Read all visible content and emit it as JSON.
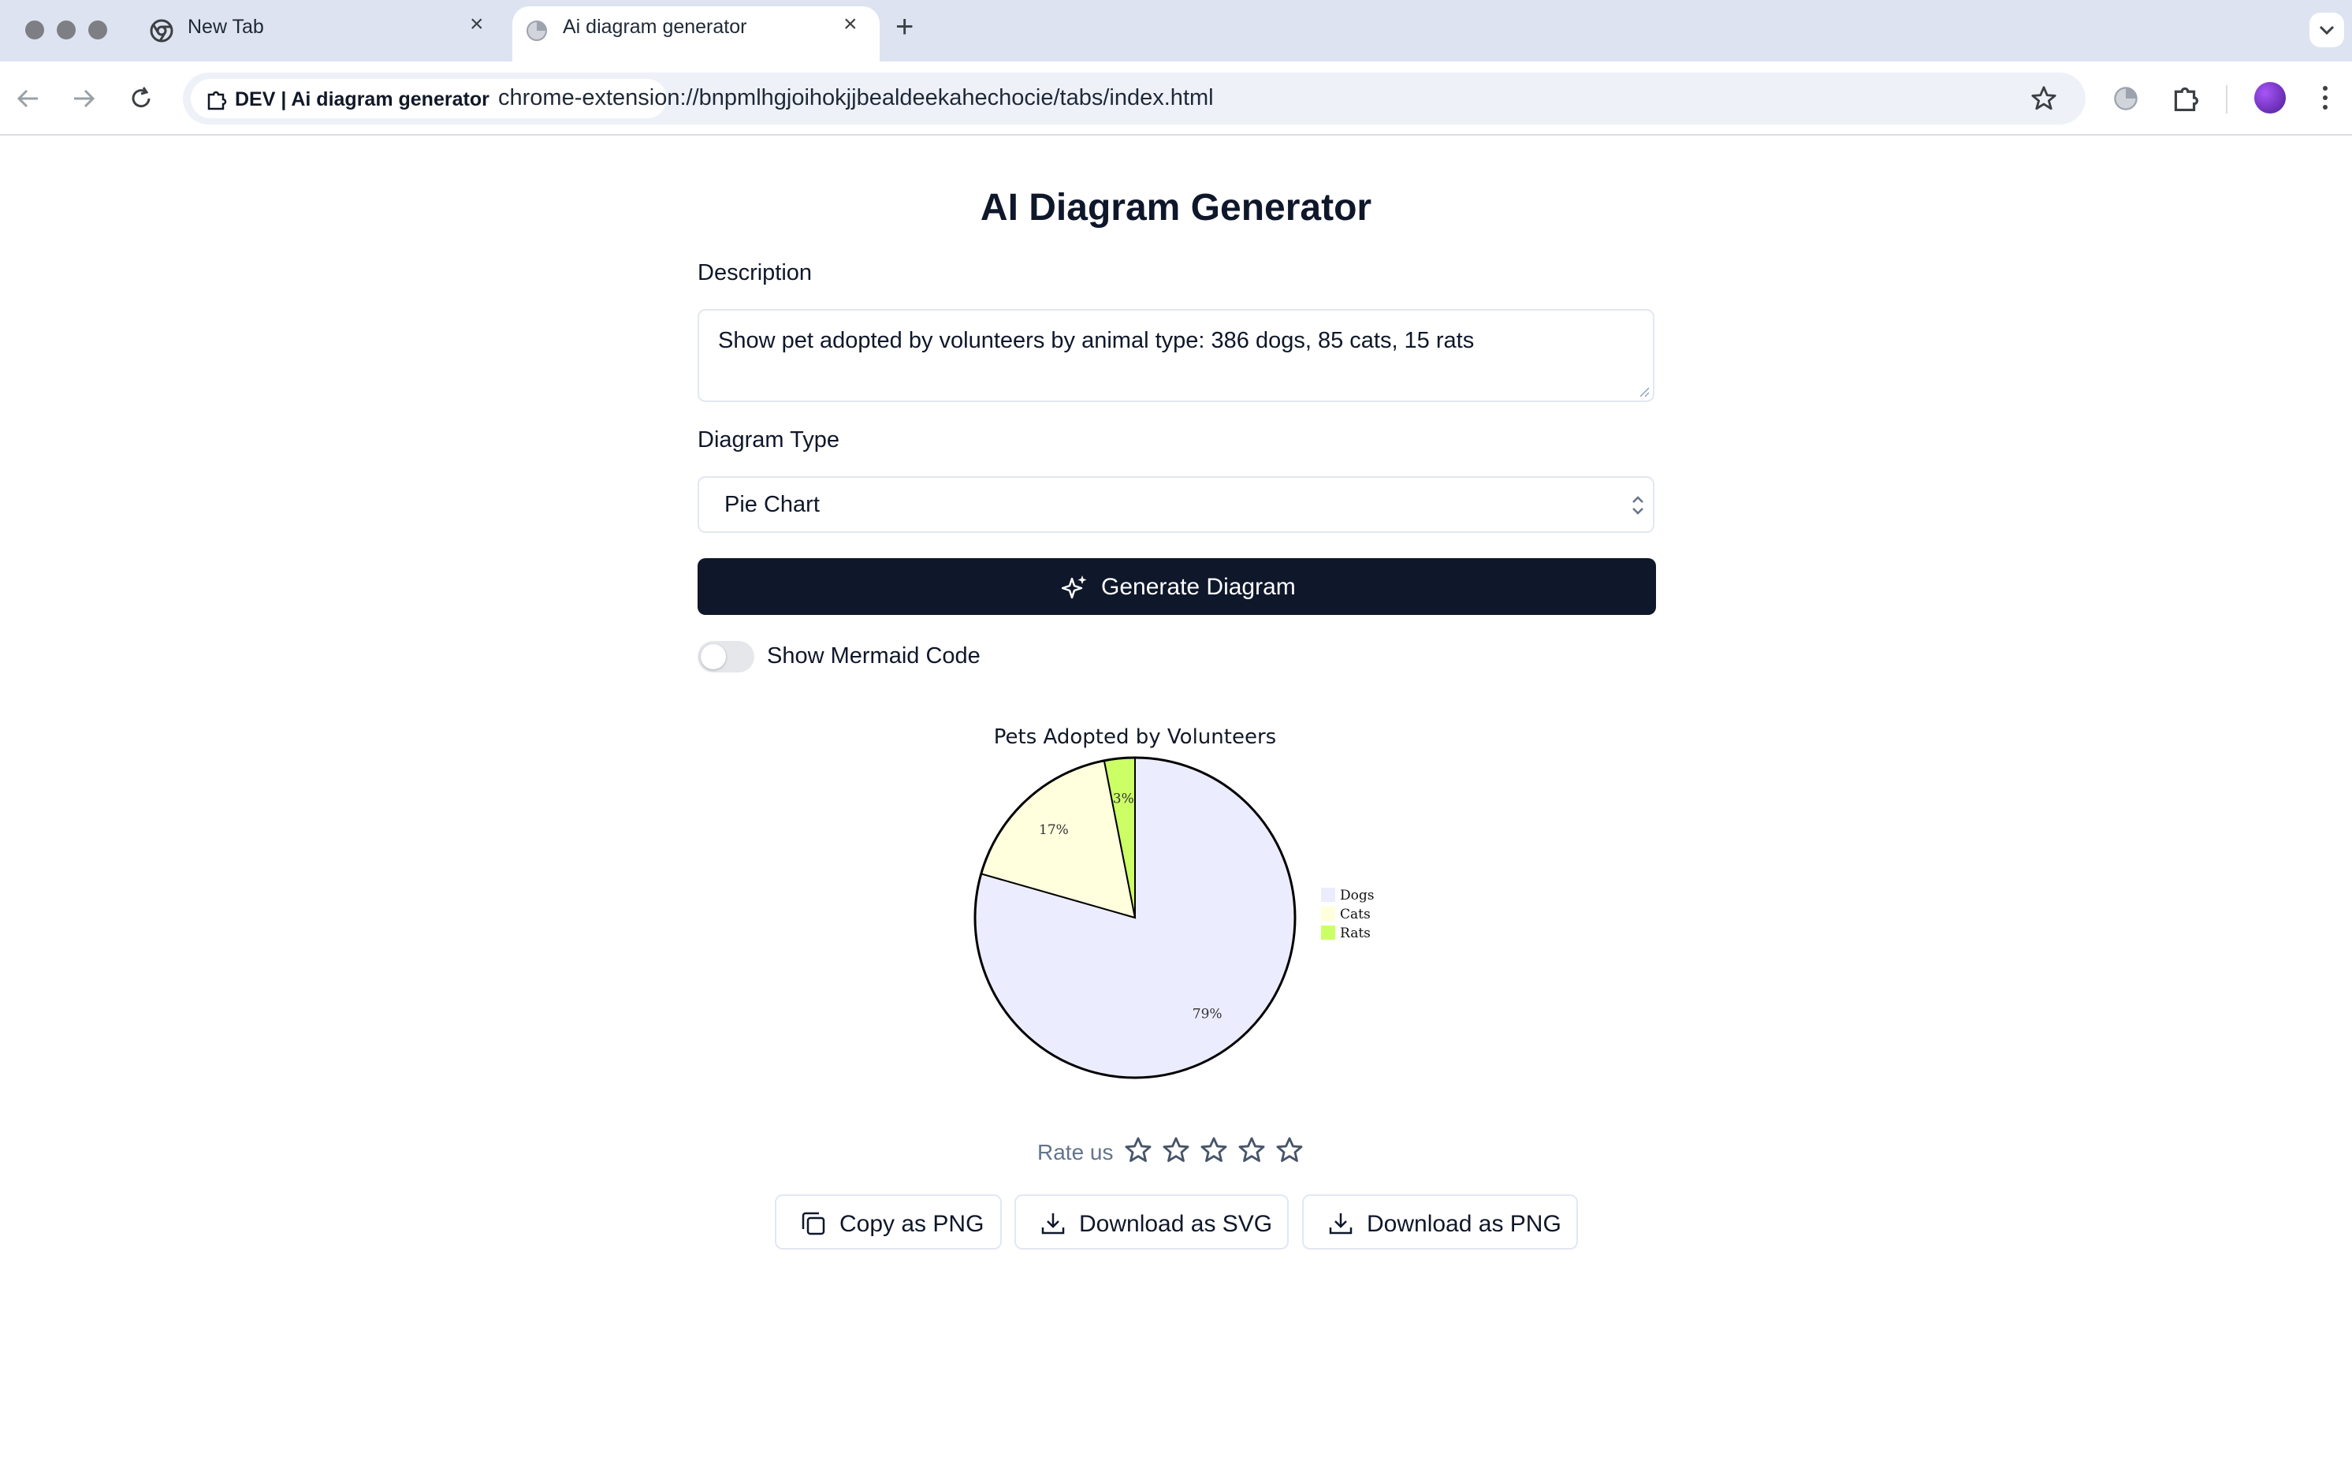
{
  "browser": {
    "tabs": [
      {
        "title": "New Tab",
        "icon": "chrome-icon"
      },
      {
        "title": "Ai diagram generator",
        "icon": "extension-favicon",
        "active": true
      }
    ],
    "site_chip": "DEV | Ai diagram generator",
    "url": "chrome-extension://bnpmlhgjoihokjjbealdeekahechocie/tabs/index.html"
  },
  "page": {
    "title": "AI Diagram Generator",
    "description_label": "Description",
    "description_value": "Show pet adopted by volunteers by animal type: 386 dogs, 85 cats, 15 rats",
    "diagram_type_label": "Diagram Type",
    "diagram_type_value": "Pie Chart",
    "generate_label": "Generate Diagram",
    "mermaid_toggle_label": "Show Mermaid Code",
    "mermaid_toggle_on": false,
    "rate_label": "Rate us",
    "rating_stars": 5,
    "actions": {
      "copy_png": "Copy as PNG",
      "download_svg": "Download as SVG",
      "download_png": "Download as PNG"
    },
    "accent_color": "#0f172a"
  },
  "chart_data": {
    "type": "pie",
    "title": "Pets Adopted by Volunteers",
    "categories": [
      "Dogs",
      "Cats",
      "Rats"
    ],
    "values": [
      386,
      85,
      15
    ],
    "slice_labels": [
      "79%",
      "17%",
      "3%"
    ],
    "colors": [
      "#ececff",
      "#ffffde",
      "#ccff66"
    ],
    "legend_position": "right"
  }
}
